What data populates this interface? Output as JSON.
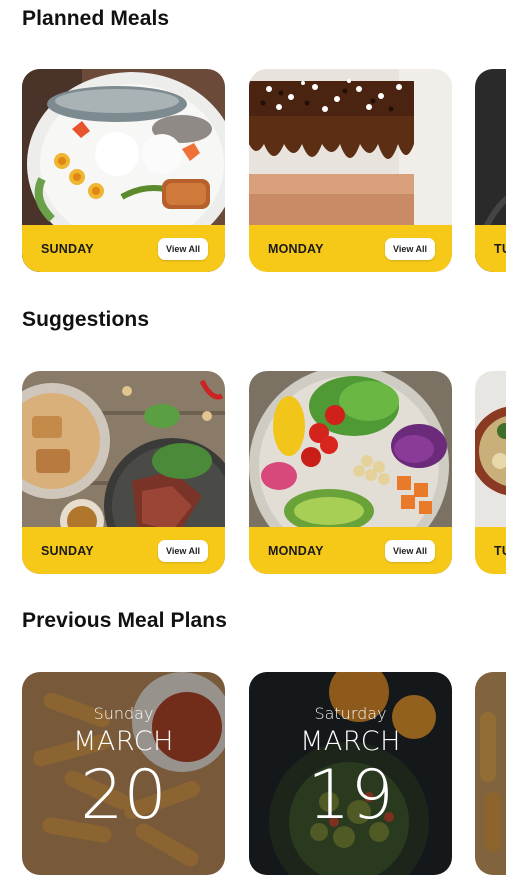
{
  "planned": {
    "title": "Planned Meals",
    "cards": [
      {
        "day": "SUNDAY",
        "button": "View All"
      },
      {
        "day": "MONDAY",
        "button": "View All"
      },
      {
        "day": "TU"
      }
    ]
  },
  "suggestions": {
    "title": "Suggestions",
    "cards": [
      {
        "day": "SUNDAY",
        "button": "View All"
      },
      {
        "day": "MONDAY",
        "button": "View All"
      },
      {
        "day": "TU"
      }
    ]
  },
  "previous": {
    "title": "Previous Meal Plans",
    "cards": [
      {
        "weekday": "Sunday",
        "month": "MARCH",
        "date": "20"
      },
      {
        "weekday": "Saturday",
        "month": "MARCH",
        "date": "19"
      }
    ]
  },
  "colors": {
    "accent": "#f6c919",
    "background": "#ffffff",
    "text": "#111111"
  }
}
